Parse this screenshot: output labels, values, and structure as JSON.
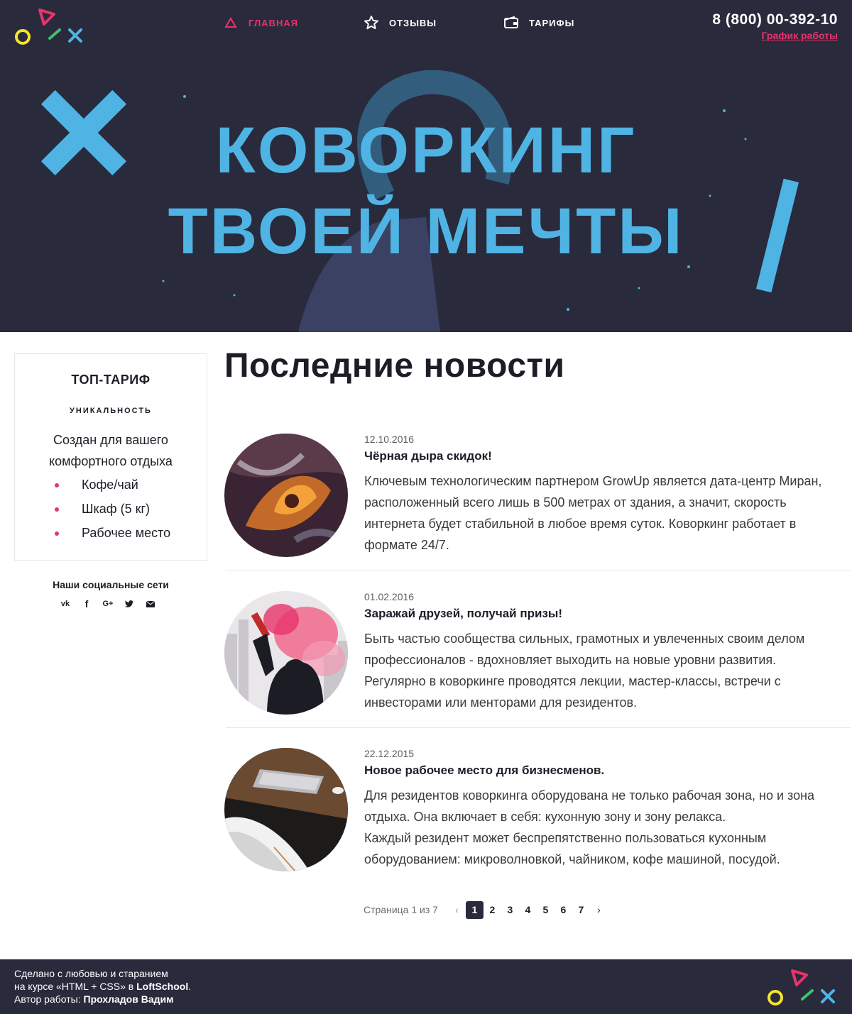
{
  "header": {
    "nav": [
      {
        "label": "ГЛАВНАЯ",
        "icon": "triangle-icon",
        "active": true
      },
      {
        "label": "ОТЗЫВЫ",
        "icon": "star-icon",
        "active": false
      },
      {
        "label": "ТАРИФЫ",
        "icon": "wallet-icon",
        "active": false
      }
    ],
    "phone": "8 (800) 00-392-10",
    "schedule_link": "График работы"
  },
  "hero": {
    "line1": "КОВОРКИНГ",
    "line2": "ТВОЕЙ МЕЧТЫ"
  },
  "sidebar": {
    "card_title": "ТОП-ТАРИФ",
    "card_subtitle": "УНИКАЛЬНОСТЬ",
    "card_description": "Создан для вашего комфортного отдыха",
    "features": [
      "Кофе/чай",
      "Шкаф (5 кг)",
      "Рабочее место"
    ],
    "social_title": "Наши социальные сети",
    "social_icons": [
      "vk-icon",
      "facebook-icon",
      "google-plus-icon",
      "twitter-icon",
      "mail-icon"
    ]
  },
  "main": {
    "title": "Последние новости",
    "news": [
      {
        "date": "12.10.2016",
        "title": "Чёрная дыра скидок!",
        "text": "Ключевым технологическим партнером GrowUp является дата-центр Миран, расположенный всего лишь в 500 метрах от здания, а значит, скорость интернета будет стабильной в любое время суток. Коворкинг работает в формате 24/7."
      },
      {
        "date": "01.02.2016",
        "title": "Заражай друзей, получай призы!",
        "text": "Быть частью сообщества сильных, грамотных и увлеченных своим делом профессионалов - вдохновляет выходить на новые уровни развития. Регулярно в коворкинге проводятся лекции, мастер-классы, встречи с инвесторами или менторами для резидентов."
      },
      {
        "date": "22.12.2015",
        "title": "Новое рабочее место для бизнесменов.",
        "text1": "Для резидентов коворкинга оборудована не только рабочая зона, но и зона отдыха. Она включает в себя: кухонную зону и зону релакса.",
        "text2": "Каждый резидент может беспрепятственно пользоваться кухонным оборудованием: микроволновкой, чайником, кофе машиной, посудой."
      }
    ],
    "pagination": {
      "label": "Страница 1 из 7",
      "pages": [
        "1",
        "2",
        "3",
        "4",
        "5",
        "6",
        "7"
      ],
      "current": "1"
    }
  },
  "footer": {
    "line1": "Сделано с любовью и старанием",
    "line2_prefix": "на курсе «HTML + CSS» в ",
    "line2_brand": "LoftSchool",
    "line2_suffix": ".",
    "line3_prefix": "Автор работы: ",
    "line3_author": "Прохладов Вадим"
  },
  "colors": {
    "dark": "#292a3c",
    "accent": "#e8336b",
    "hero_blue": "#4fb4e4"
  }
}
